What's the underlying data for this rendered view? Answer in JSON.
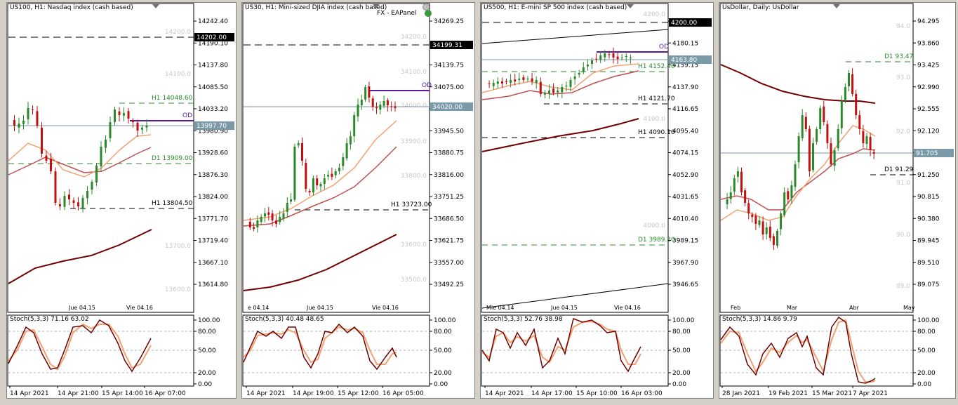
{
  "charts": [
    {
      "title": "US100, H1:  Nasdaq index (cash based)",
      "price_ticks": [
        "14242.40",
        "14190.10",
        "14137.80",
        "14085.50",
        "14033.20",
        "13980.90",
        "13928.60",
        "13876.30",
        "13824.00",
        "13771.70",
        "13719.40",
        "13667.10",
        "13614.80"
      ],
      "faint_levels": [
        "14200.0",
        "14100.0",
        "13700.0",
        "13600.0"
      ],
      "price_tag": "13997.70",
      "dark_tag": "14202.00",
      "levels": [
        {
          "label": "H1 14048.60",
          "color": "#2a8a2a"
        },
        {
          "label": "OD",
          "color": "#5a1aa0"
        },
        {
          "label": "D1 13909.00",
          "color": "#2a8a2a"
        },
        {
          "label": "H1 13804.50",
          "color": "#000000"
        }
      ],
      "time_axis": [
        "Jue 04.15",
        "Vie 04.16"
      ],
      "stoch_label": "Stoch(5,3,3) 71.16 63.02",
      "stoch_ticks": [
        "100.00",
        "80.00",
        "50.00",
        "20.00",
        "0.00"
      ],
      "bottom_axis": [
        "14 Apr 2021",
        "14 Apr 21:00",
        "15 Apr 14:00",
        "16 Apr 07:00"
      ]
    },
    {
      "title": "US30, H1:  Mini-sized DJIA index (cash based)",
      "eapanel": "FX - EAPanel",
      "price_ticks": [
        "34269.25",
        "34204.20",
        "34139.75",
        "34075.00",
        "34010.25",
        "33945.50",
        "33880.75",
        "33816.00",
        "33751.25",
        "33686.50",
        "33621.75",
        "33557.00",
        "33492.25"
      ],
      "faint_levels": [
        "34200.0",
        "34100.0",
        "34000.0",
        "33900.0",
        "33800.0",
        "33600.0",
        "33500.0"
      ],
      "price_tag": "34020.00",
      "dark_tag": "34199.31",
      "levels": [
        {
          "label": "OD",
          "color": "#5a1aa0"
        },
        {
          "label": "H1 33723.00",
          "color": "#000000"
        }
      ],
      "time_axis": [
        "e 04.14",
        "Jue 04.15",
        "Vie 04.16"
      ],
      "stoch_label": "Stoch(5,3,3) 40.48 48.65",
      "stoch_ticks": [
        "100.00",
        "80.00",
        "50.00",
        "20.00",
        "0.00"
      ],
      "bottom_axis": [
        "14 Apr 2021",
        "14 Apr 19:00",
        "15 Apr 12:00",
        "16 Apr 05:00"
      ]
    },
    {
      "title": "US500, H1:  E-mini SP 500 index (cash based)",
      "price_ticks": [
        "4200.00",
        "4180.15",
        "4159.15",
        "4137.90",
        "4116.65",
        "4095.40",
        "4074.15",
        "4052.90",
        "4031.65",
        "4010.40",
        "3989.15",
        "3967.90",
        "3946.65"
      ],
      "faint_levels": [
        "4200.0",
        "4100.0",
        "4000.0"
      ],
      "price_tag": "4163.80",
      "dark_tag": "4200.00",
      "levels": [
        {
          "label": "OD",
          "color": "#5a1aa0"
        },
        {
          "label": "H1 4152.40",
          "color": "#2a8a2a"
        },
        {
          "label": "H1 4121.70",
          "color": "#000000"
        },
        {
          "label": "H1 4090.10",
          "color": "#000000"
        },
        {
          "label": "D1 3989.30",
          "color": "#2a8a2a"
        }
      ],
      "time_axis": [
        "Mie 04.14",
        "Jue 04.15",
        "Vie 04.16"
      ],
      "stoch_label": "Stoch(5,3,3) 52.76 38.98",
      "stoch_ticks": [
        "100.00",
        "80.00",
        "50.00",
        "20.00",
        "0.00"
      ],
      "bottom_axis": [
        "14 Apr 2021",
        "14 Apr 17:00",
        "15 Apr 10:00",
        "16 Apr 03:00"
      ]
    },
    {
      "title": "UsDollar, Daily:  UsDollar",
      "price_ticks": [
        "94.295",
        "93.860",
        "93.425",
        "92.990",
        "92.555",
        "92.120",
        "91.685",
        "91.250",
        "90.815",
        "90.380",
        "89.945",
        "89.510",
        "89.075"
      ],
      "faint_levels": [
        "94.0",
        "93.0",
        "92.0",
        "91.0",
        "90.0",
        "89.0"
      ],
      "price_tag": "91.705",
      "levels": [
        {
          "label": "D1 93.47",
          "color": "#2a8a2a"
        },
        {
          "label": "D1 91.29",
          "color": "#000000"
        }
      ],
      "time_axis": [
        "Feb",
        "Mar",
        "Abr",
        "May"
      ],
      "stoch_label": "Stoch(5,3,3) 14.86 9.79",
      "stoch_ticks": [
        "100.00",
        "80.00",
        "50.00",
        "20.00",
        "0.00"
      ],
      "bottom_axis": [
        "28 Jan 2021",
        "19 Feb 2021",
        "15 Mar 2021",
        "7 Apr 2021"
      ]
    }
  ],
  "colors": {
    "bull": "#2a8a2a",
    "bear": "#c01010",
    "ma_fast": "#f4a070",
    "ma_mid": "#c05050",
    "ma_slow": "#700000",
    "stoch_main": "#700000",
    "stoch_signal": "#f4a070"
  }
}
